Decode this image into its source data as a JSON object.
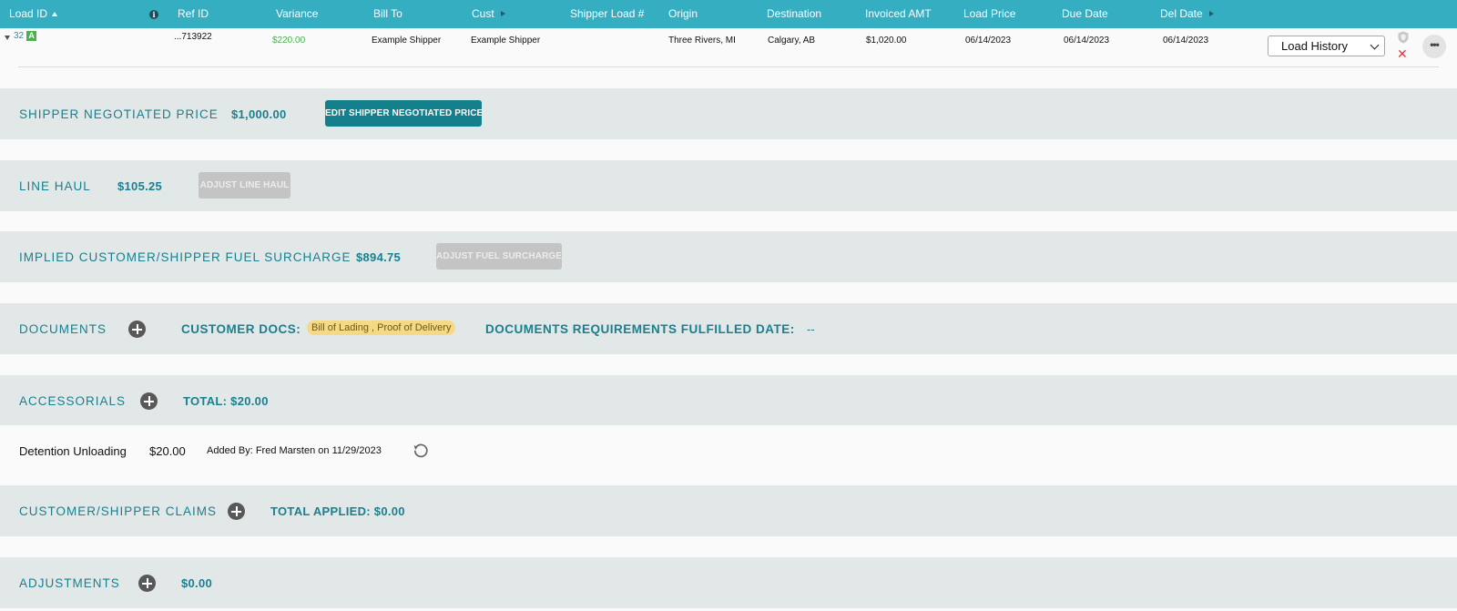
{
  "header": {
    "load_id": "Load ID",
    "ref_id": "Ref ID",
    "variance": "Variance",
    "bill_to": "Bill To",
    "cust": "Cust",
    "shipper_load": "Shipper Load #",
    "origin": "Origin",
    "destination": "Destination",
    "invoiced_amt": "Invoiced AMT",
    "load_price": "Load Price",
    "due_date": "Due Date",
    "del_date": "Del Date",
    "info_glyph": "i"
  },
  "row": {
    "load_id": "32",
    "badge": "A",
    "ref_id": "...713922",
    "variance": "$220.00",
    "bill_to": "Example Shipper",
    "cust": "Example Shipper",
    "shipper_load": "",
    "origin": "Three Rivers, MI",
    "destination": "Calgary, AB",
    "invoiced_amt": "$1,020.00",
    "load_price": "06/14/2023",
    "due_date": "06/14/2023",
    "del_date": "06/14/2023",
    "select_value": "Load History",
    "close_glyph": "✕",
    "more_glyph": "•••"
  },
  "shipper_price": {
    "label": "SHIPPER NEGOTIATED PRICE",
    "value": "$1,000.00",
    "button": "EDIT SHIPPER NEGOTIATED PRICE"
  },
  "line_haul": {
    "label": "LINE HAUL",
    "value": "$105.25",
    "button": "ADJUST LINE HAUL"
  },
  "fuel": {
    "label": "IMPLIED CUSTOMER/SHIPPER FUEL SURCHARGE",
    "value": "$894.75",
    "button": "ADJUST FUEL SURCHARGE"
  },
  "documents": {
    "label": "DOCUMENTS",
    "customer_docs_label": "CUSTOMER DOCS:",
    "customer_docs_value": "Bill of Lading , Proof of Delivery",
    "fulfilled_label": "DOCUMENTS REQUIREMENTS FULFILLED DATE:",
    "fulfilled_value": "--"
  },
  "accessorials": {
    "label": "ACCESSORIALS",
    "total": "TOTAL: $20.00",
    "items": [
      {
        "name": "Detention Unloading",
        "amount": "$20.00",
        "added_by": "Added By: Fred Marsten on 11/29/2023"
      }
    ]
  },
  "claims": {
    "label": "CUSTOMER/SHIPPER CLAIMS",
    "total": "TOTAL APPLIED: $0.00"
  },
  "adjustments": {
    "label": "ADJUSTMENTS",
    "value": "$0.00"
  },
  "colors": {
    "header_bg": "#36aec2",
    "accent": "#1a7f8e",
    "section_bg": "#e2e7e8",
    "positive": "#4caf50",
    "delete": "#e53935",
    "doc_highlight": "#f5d985"
  }
}
